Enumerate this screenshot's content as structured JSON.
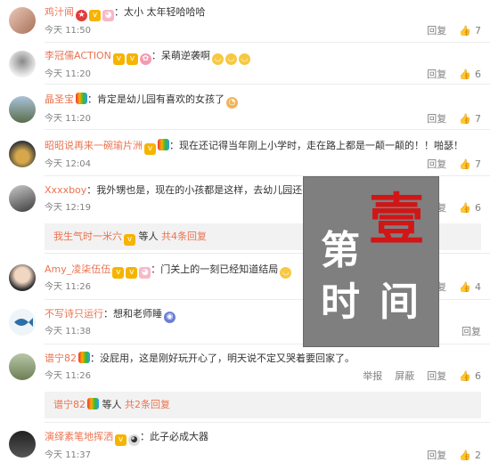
{
  "labels": {
    "reply": "回复",
    "report": "举报",
    "block": "屏蔽"
  },
  "comments": [
    {
      "user": "鸡汁闻",
      "text": "：太小 太年轻哈哈哈",
      "date": "今天",
      "time": "11:50",
      "likes": "7"
    },
    {
      "user": "李冠儒ACTION",
      "text": "：呆萌逆袭啊",
      "date": "今天",
      "time": "11:20",
      "likes": "6"
    },
    {
      "user": "晶圣宝",
      "text": "：肯定是幼儿园有喜欢的女孩了",
      "date": "今天",
      "time": "11:20",
      "likes": "7"
    },
    {
      "user": "昭昭说再来一碗瑜片洲",
      "text": "：现在还记得当年刚上小学时，走在路上都是一颠一颠的！！啪瑟！",
      "date": "今天",
      "time": "12:04",
      "likes": "7"
    },
    {
      "user": "Xxxxboy",
      "text": "：我外甥也是，现在的小孩都是这样，去幼儿园还不哭，特别乖",
      "date": "今天",
      "time": "12:19",
      "likes": "6"
    },
    {
      "user": "Amy_凌柒伍伍",
      "text": "：门关上的一刻已经知道结局",
      "date": "今天",
      "time": "11:26",
      "likes": "4"
    },
    {
      "user": "不写诗只运行",
      "text": "：想和老师睡",
      "date": "今天",
      "time": "11:38",
      "likes": ""
    },
    {
      "user": "谱宁82",
      "text": "：没屁用，这是刚好玩开心了，明天说不定又哭着要回家了。",
      "date": "今天",
      "time": "11:26",
      "likes": "6"
    },
    {
      "user": "演绎素笔地挥洒",
      "text": "：此子必成大器",
      "date": "今天",
      "time": "11:37",
      "likes": "2"
    }
  ],
  "subreplies": [
    {
      "user": "我生气时一米六",
      "text": "等人",
      "count": "共4条回复"
    },
    {
      "user": "谱宁82",
      "text": "等人",
      "count": "共2条回复"
    }
  ],
  "stamp": {
    "c1": "第",
    "c2": "壹",
    "c3": "时",
    "c4": "间"
  },
  "colors": {
    "username": "#eb7350",
    "meta": "#808080",
    "subreply_bg": "#f2f2f2",
    "stamp_bg": "#7f7f7f",
    "stamp_red": "#d01616"
  }
}
